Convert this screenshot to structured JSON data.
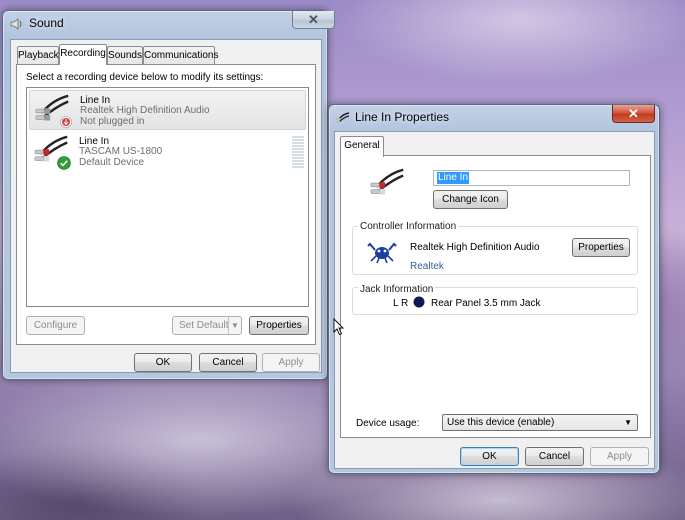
{
  "sound_dialog": {
    "title": "Sound",
    "close_symbol": "✕",
    "tabs": [
      {
        "label": "Playback"
      },
      {
        "label": "Recording",
        "active": true
      },
      {
        "label": "Sounds"
      },
      {
        "label": "Communications"
      }
    ],
    "instruction": "Select a recording device below to modify its settings:",
    "devices": [
      {
        "name": "Line In",
        "driver": "Realtek High Definition Audio",
        "status": "Not plugged in",
        "status_icon": "unplugged-down-arrow-icon",
        "selected": true
      },
      {
        "name": "Line In",
        "driver": "TASCAM US-1800",
        "status": "Default Device",
        "status_icon": "green-check-icon",
        "level_meter": true
      }
    ],
    "buttons": {
      "configure": "Configure",
      "set_default": "Set Default",
      "properties": "Properties"
    },
    "footer": {
      "ok": "OK",
      "cancel": "Cancel",
      "apply": "Apply"
    }
  },
  "props_dialog": {
    "title": "Line In Properties",
    "close_symbol": "✕",
    "tabs": [
      {
        "label": "General",
        "active": true
      }
    ],
    "device_name": "Line In",
    "change_icon": "Change Icon",
    "controller": {
      "heading": "Controller Information",
      "name": "Realtek High Definition Audio",
      "vendor": "Realtek",
      "properties": "Properties"
    },
    "jack": {
      "heading": "Jack Information",
      "channels": "L R",
      "description": "Rear Panel 3.5 mm Jack",
      "color": "#0d1a55"
    },
    "usage": {
      "label": "Device usage:",
      "value": "Use this device (enable)"
    },
    "footer": {
      "ok": "OK",
      "cancel": "Cancel",
      "apply": "Apply"
    }
  },
  "colors": {
    "selection": "#3399ff",
    "close_active": "#c23a1e",
    "link": "#3b5ba5"
  }
}
